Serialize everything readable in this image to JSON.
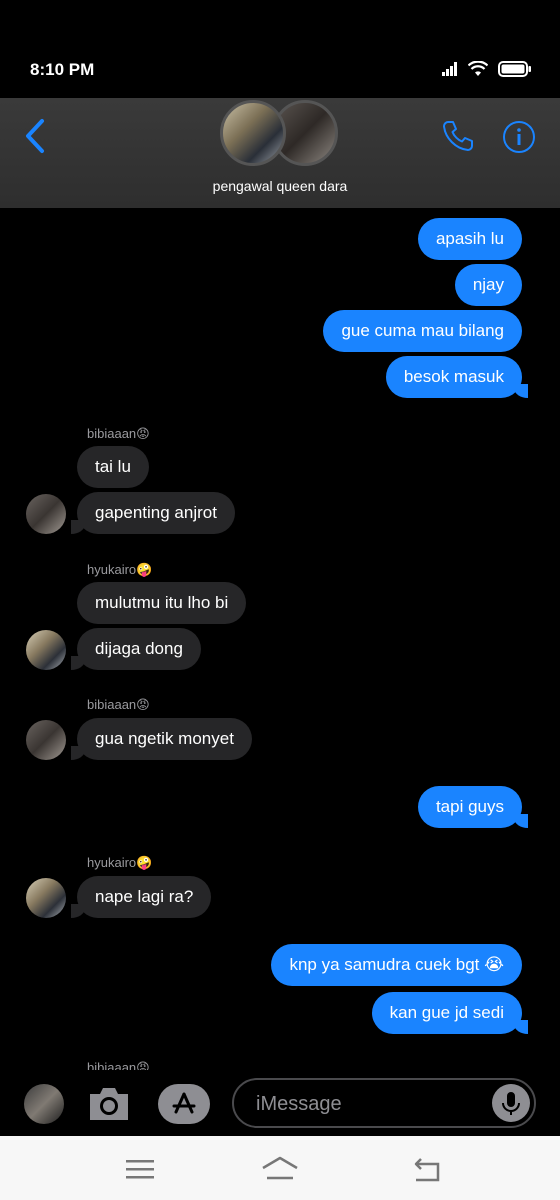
{
  "status": {
    "time": "8:10 PM"
  },
  "header": {
    "group_name": "pengawal queen dara"
  },
  "messages": {
    "m1": "apasih lu",
    "m2": "njay",
    "m3": "gue cuma mau bilang",
    "m4": "besok masuk",
    "s1": "bibiaaan😡",
    "m5": "tai lu",
    "m6": "gapenting anjrot",
    "s2": "hyukairo🤪",
    "m7": "mulutmu itu lho bi",
    "m8": "dijaga dong",
    "s3": "bibiaaan😡",
    "m9": "gua ngetik monyet",
    "m10": "tapi guys",
    "s4": "hyukairo🤪",
    "m11": "nape lagi ra?",
    "m12": "knp ya samudra cuek bgt 😭",
    "m13": "kan gue jd sedi",
    "s5": "bibiaaan😡"
  },
  "composer": {
    "placeholder": "iMessage"
  },
  "colors": {
    "accent": "#1a84ff",
    "incoming_bubble": "#262628"
  },
  "icons": [
    "signal-icon",
    "wifi-icon",
    "battery-icon",
    "back-chevron-icon",
    "phone-icon",
    "info-icon",
    "camera-icon",
    "app-store-icon",
    "mic-icon",
    "menu-icon",
    "home-icon",
    "back-icon"
  ]
}
